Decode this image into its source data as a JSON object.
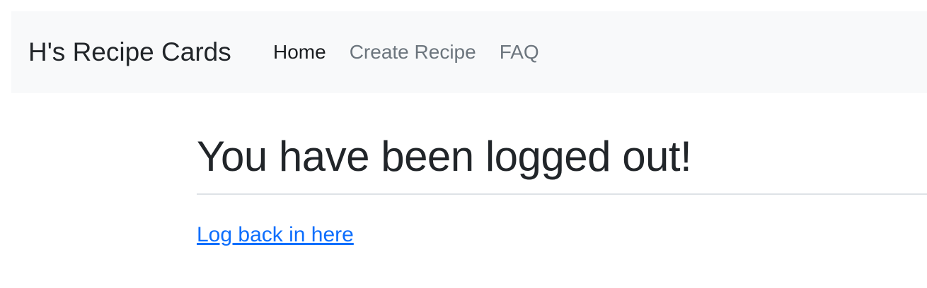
{
  "navbar": {
    "brand": "H's Recipe Cards",
    "links": [
      {
        "label": "Home",
        "active": true
      },
      {
        "label": "Create Recipe",
        "active": false
      },
      {
        "label": "FAQ",
        "active": false
      }
    ]
  },
  "main": {
    "title": "You have been logged out!",
    "login_link": "Log back in here"
  },
  "colors": {
    "navbar_bg": "#f8f9fa",
    "link": "#0d6efd",
    "text": "#212529",
    "muted": "#6c757d"
  }
}
